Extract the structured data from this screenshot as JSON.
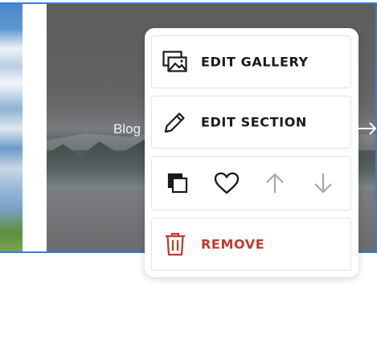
{
  "canvas": {
    "blog_label": "Blog"
  },
  "menu": {
    "edit_gallery_label": "EDIT GALLERY",
    "edit_section_label": "EDIT SECTION",
    "remove_label": "REMOVE",
    "actions": {
      "duplicate_icon": "duplicate-icon",
      "favorite_icon": "heart-icon",
      "move_up_icon": "arrow-up-icon",
      "move_down_icon": "arrow-down-icon"
    }
  },
  "colors": {
    "selection_border": "#2f7fe6",
    "remove_red": "#c0392b",
    "disabled_gray": "#a8a8a8",
    "text_dark": "#1a1a1a"
  }
}
